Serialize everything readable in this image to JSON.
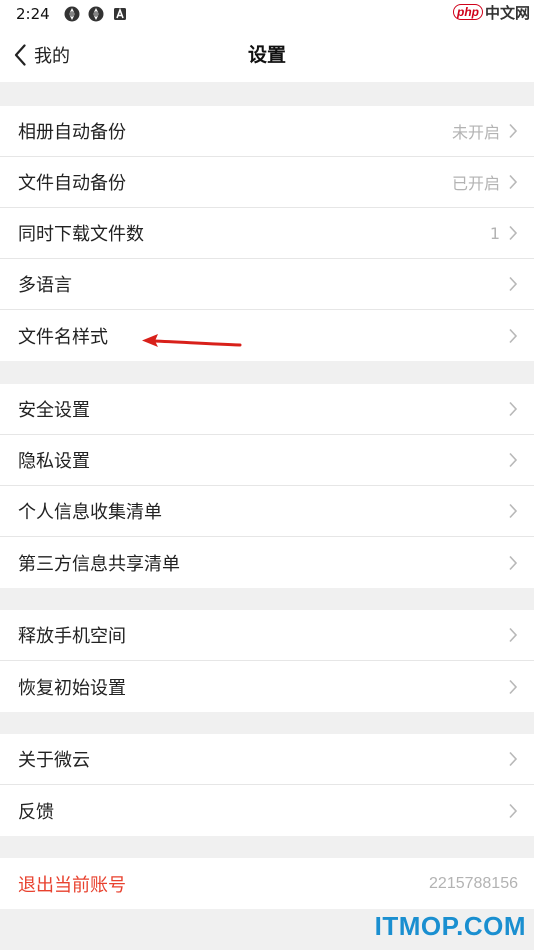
{
  "status_bar": {
    "time": "2:24"
  },
  "watermark_top": {
    "brand": "php",
    "suffix": "中文网"
  },
  "nav": {
    "back_label": "我的",
    "title": "设置"
  },
  "groups": [
    {
      "items": [
        {
          "label": "相册自动备份",
          "value": "未开启"
        },
        {
          "label": "文件自动备份",
          "value": "已开启"
        },
        {
          "label": "同时下载文件数",
          "value": "1"
        },
        {
          "label": "多语言",
          "value": ""
        },
        {
          "label": "文件名样式",
          "value": ""
        }
      ]
    },
    {
      "items": [
        {
          "label": "安全设置",
          "value": ""
        },
        {
          "label": "隐私设置",
          "value": ""
        },
        {
          "label": "个人信息收集清单",
          "value": ""
        },
        {
          "label": "第三方信息共享清单",
          "value": ""
        }
      ]
    },
    {
      "items": [
        {
          "label": "释放手机空间",
          "value": ""
        },
        {
          "label": "恢复初始设置",
          "value": ""
        }
      ]
    },
    {
      "items": [
        {
          "label": "关于微云",
          "value": ""
        },
        {
          "label": "反馈",
          "value": ""
        }
      ]
    }
  ],
  "logout": {
    "label": "退出当前账号",
    "account_id": "2215788156"
  },
  "watermark_bottom": "ITMOP.COM",
  "colors": {
    "background": "#f0f0f0",
    "logout_red": "#e8412e",
    "value_gray": "#b3b3b3",
    "arrow_red": "#d8201a",
    "watermark_blue": "#1a8fd0"
  }
}
